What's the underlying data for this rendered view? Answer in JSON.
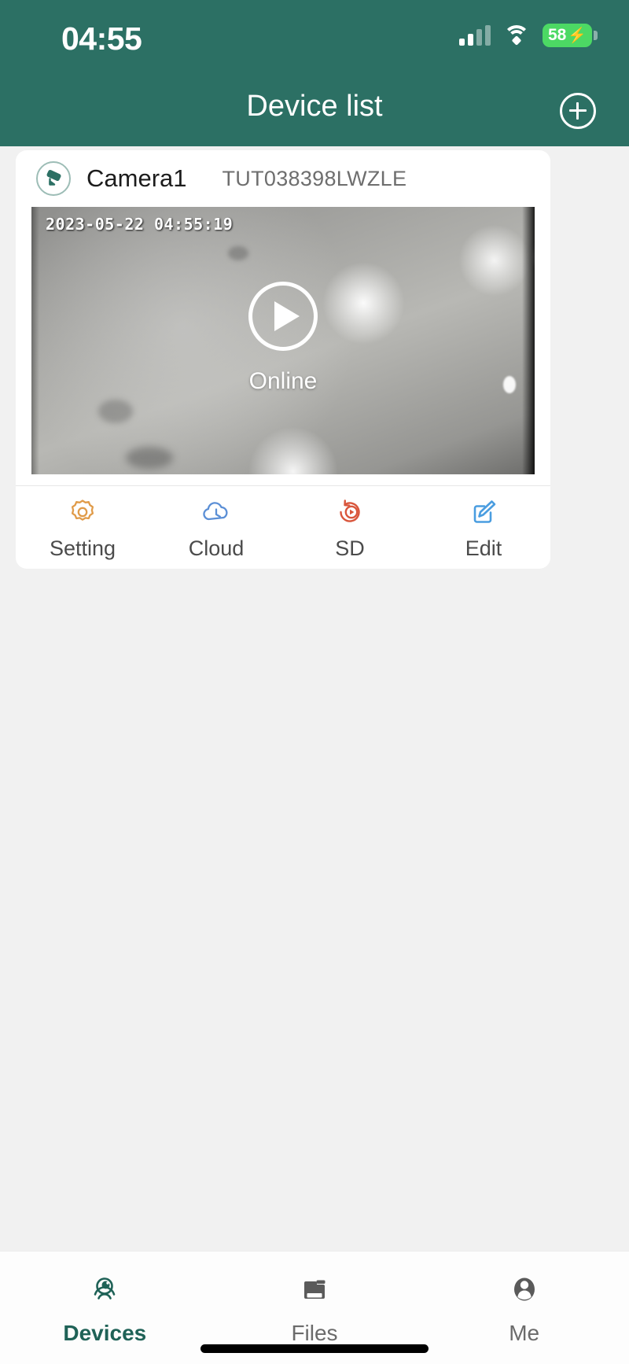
{
  "status_bar": {
    "time": "04:55",
    "battery_percent": "58",
    "charging_glyph": "⚡",
    "signal_icon": "cellular-signal-icon",
    "wifi_icon": "wifi-icon",
    "battery_icon": "battery-charging-icon"
  },
  "nav": {
    "title": "Device list",
    "add_icon": "plus-circle-icon"
  },
  "device": {
    "badge_icon": "cctv-camera-icon",
    "name": "Camera1",
    "uid": "TUT038398LWZLE",
    "preview": {
      "timestamp": "2023-05-22 04:55:19",
      "status": "Online",
      "play_icon": "play-circle-icon"
    },
    "actions": [
      {
        "label": "Setting",
        "icon": "gear-icon",
        "color": "#e09b49"
      },
      {
        "label": "Cloud",
        "icon": "cloud-clock-icon",
        "color": "#5b8fd6"
      },
      {
        "label": "SD",
        "icon": "replay-sd-icon",
        "color": "#d9563c"
      },
      {
        "label": "Edit",
        "icon": "edit-pencil-icon",
        "color": "#4a9de0"
      }
    ]
  },
  "tabbar": {
    "items": [
      {
        "label": "Devices",
        "icon": "dome-camera-icon",
        "active": true
      },
      {
        "label": "Files",
        "icon": "folder-icon",
        "active": false
      },
      {
        "label": "Me",
        "icon": "person-icon",
        "active": false
      }
    ]
  },
  "colors": {
    "header_teal": "#2c7064",
    "accent_teal": "#1f6257",
    "page_bg": "#f1f1f1",
    "card_bg": "#ffffff",
    "battery_green": "#4cd964"
  }
}
